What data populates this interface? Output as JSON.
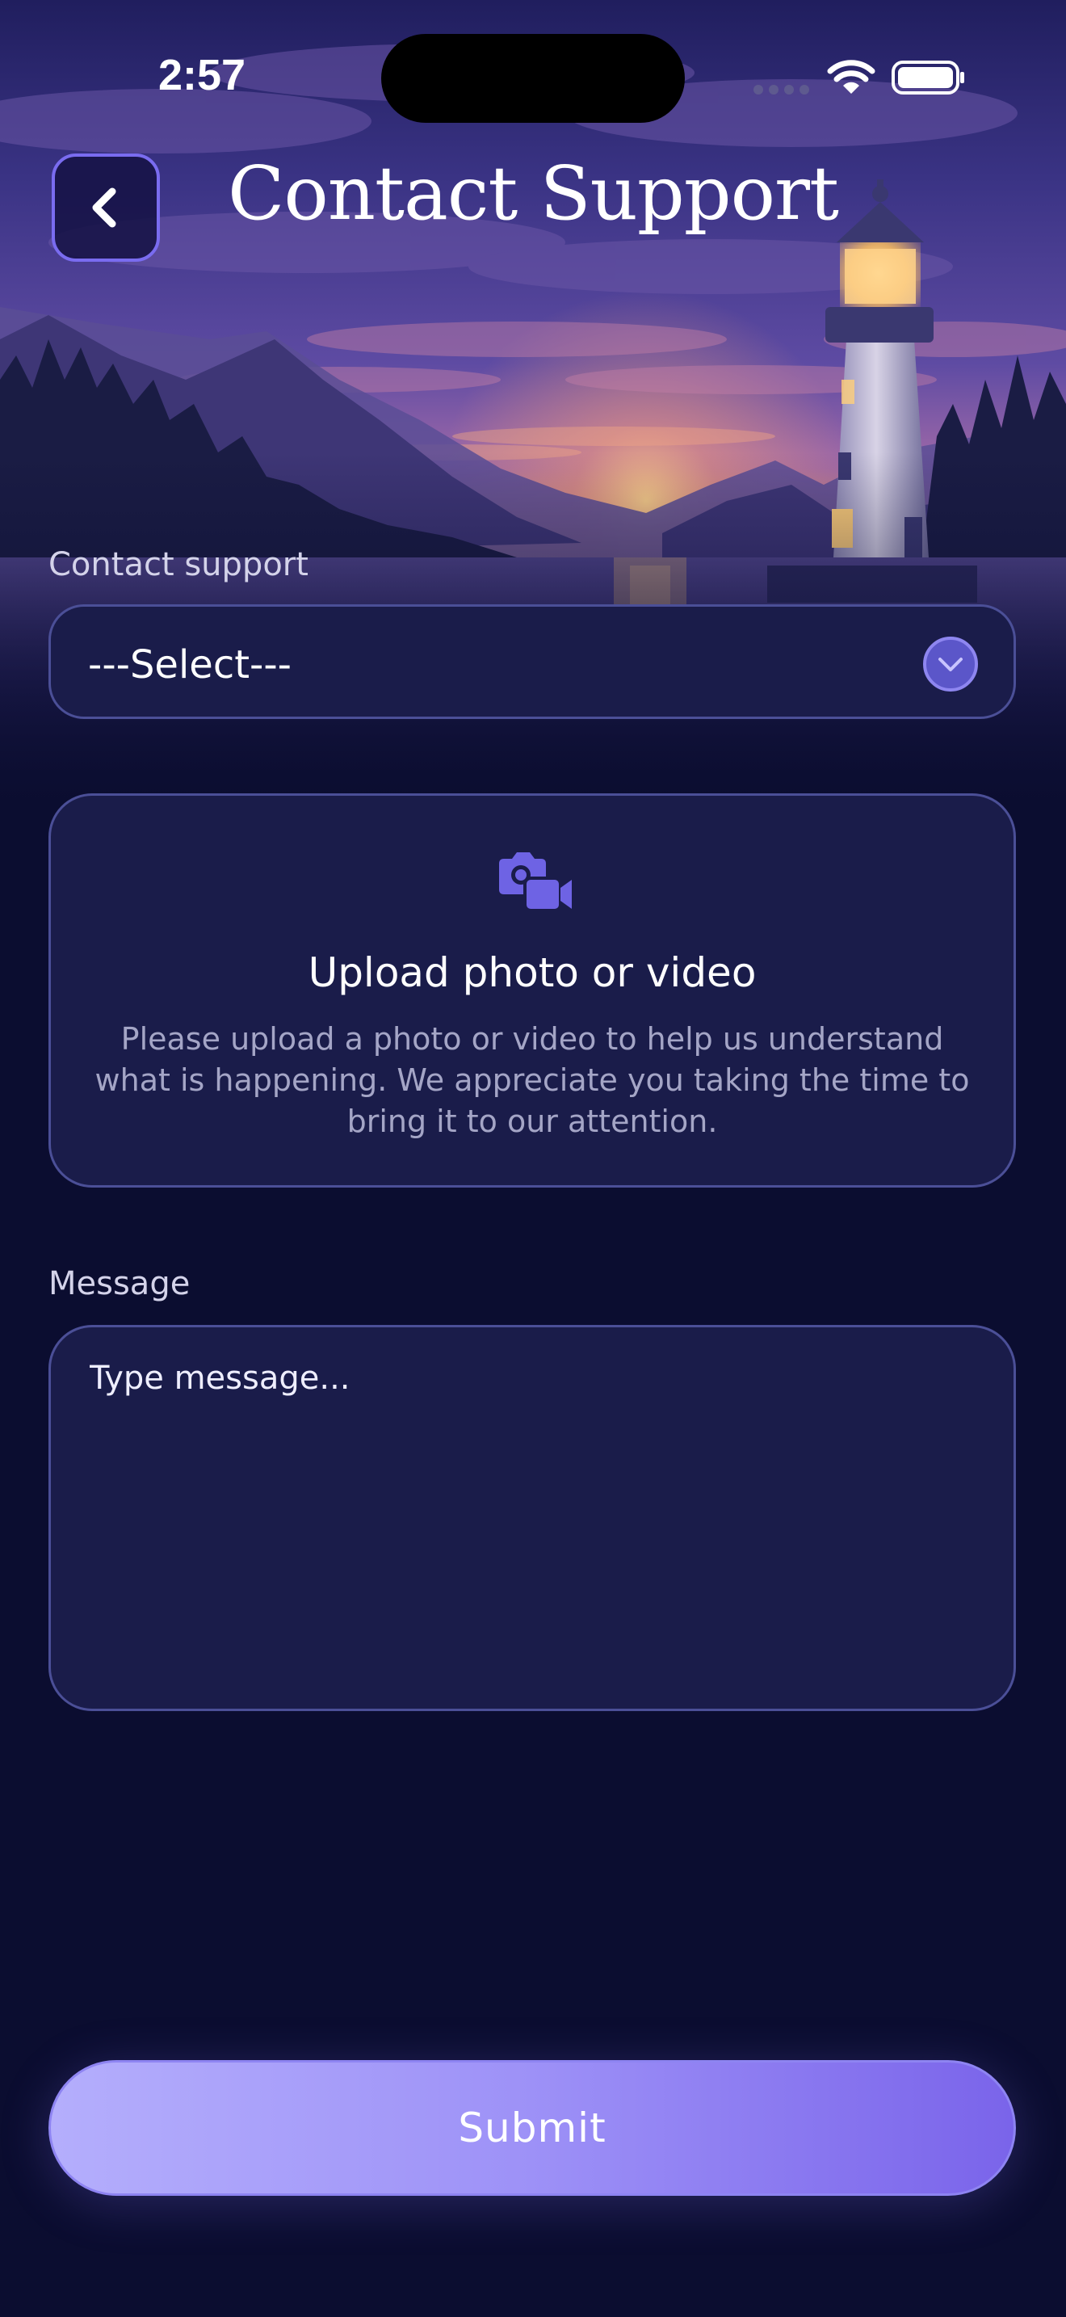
{
  "status_bar": {
    "time": "2:57"
  },
  "header": {
    "title": "Contact Support",
    "back_icon": "chevron-left-icon"
  },
  "contact_support": {
    "label": "Contact support",
    "selected_value": "---Select---",
    "dropdown_icon": "chevron-down-icon"
  },
  "upload": {
    "icon": "camera-video-icon",
    "title": "Upload photo or video",
    "description": "Please upload a photo or video to help us understand what is happening. We appreciate you taking the time to bring it to our attention."
  },
  "message": {
    "label": "Message",
    "placeholder": "Type message..."
  },
  "submit": {
    "label": "Submit"
  },
  "colors": {
    "background": "#0b0d30",
    "card": "#1a1c4a",
    "card_border": "#4b4f97",
    "accent": "#7a6cf0",
    "submit_gradient_start": "#b4aefc",
    "submit_gradient_end": "#7a64ea"
  }
}
